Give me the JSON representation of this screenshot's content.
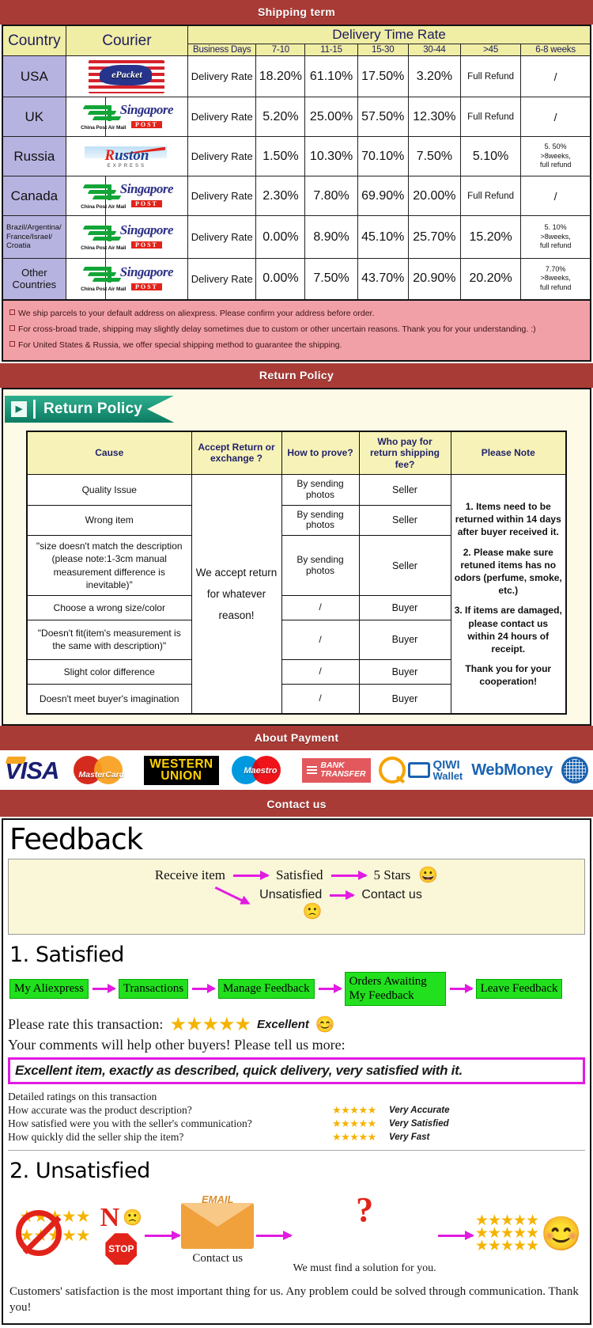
{
  "sections": {
    "shipping_banner": "Shipping term",
    "return_banner": "Return Policy",
    "payment_banner": "About Payment",
    "contact_banner": "Contact us"
  },
  "shipping": {
    "headers": {
      "country": "Country",
      "courier": "Courier",
      "delivery_time_rate": "Delivery Time Rate",
      "business_days": "Business Days",
      "d1": "7-10",
      "d2": "11-15",
      "d3": "15-30",
      "d4": "30-44",
      "d5": ">45",
      "d6": "6-8 weeks"
    },
    "rate_label": "Delivery Rate",
    "rows": [
      {
        "country": "USA",
        "couriers": [
          "epacket-logo"
        ],
        "rate_label": "Delivery Rate",
        "v1": "18.20%",
        "v2": "61.10%",
        "v3": "17.50%",
        "v4": "3.20%",
        "v5": "Full Refund",
        "v6": "/"
      },
      {
        "country": "UK",
        "couriers": [
          "china-post-air-mail-logo",
          "singapore-post-logo"
        ],
        "rate_label": "Delivery Rate",
        "v1": "5.20%",
        "v2": "25.00%",
        "v3": "57.50%",
        "v4": "12.30%",
        "v5": "Full Refund",
        "v6": "/"
      },
      {
        "country": "Russia",
        "couriers": [
          "ruston-express-logo"
        ],
        "rate_label": "Delivery Rate",
        "v1": "1.50%",
        "v2": "10.30%",
        "v3": "70.10%",
        "v4": "7.50%",
        "v5": "5.10%",
        "v6": "5. 50%\n>8weeks,\nfull refund"
      },
      {
        "country": "Canada",
        "couriers": [
          "china-post-air-mail-logo",
          "singapore-post-logo"
        ],
        "rate_label": "Delivery Rate",
        "v1": "2.30%",
        "v2": "7.80%",
        "v3": "69.90%",
        "v4": "20.00%",
        "v5": "Full Refund",
        "v6": "/"
      },
      {
        "country": "Brazil/Argentina/ France/Israel/ Croatia",
        "couriers": [
          "china-post-air-mail-logo",
          "singapore-post-logo"
        ],
        "rate_label": "Delivery Rate",
        "v1": "0.00%",
        "v2": "8.90%",
        "v3": "45.10%",
        "v4": "25.70%",
        "v5": "15.20%",
        "v6": "5. 10%\n>8weeks,\nfull refund"
      },
      {
        "country": "Other Countries",
        "couriers": [
          "china-post-air-mail-logo",
          "singapore-post-logo"
        ],
        "rate_label": "Delivery Rate",
        "v1": "0.00%",
        "v2": "7.50%",
        "v3": "43.70%",
        "v4": "20.90%",
        "v5": "20.20%",
        "v6": "7.70%\n>8weeks,\nfull refund"
      }
    ],
    "notices": [
      "We ship parcels to your default address on aliexpress. Please confirm your address before order.",
      "For cross-broad trade, shipping may slightly delay sometimes due to custom or other uncertain reasons. Thank you for your understanding. :)",
      "For United States & Russia, we offer special shipping method to guarantee the shipping."
    ]
  },
  "return_policy": {
    "tag_label": "Return Policy",
    "headers": {
      "cause": "Cause",
      "accept": "Accept Return or exchange ?",
      "prove": "How to prove?",
      "who_pays": "Who pay for return shipping fee?",
      "note": "Please Note"
    },
    "accept_text": "We accept return for whatever reason!",
    "rows": [
      {
        "cause": "Quality Issue",
        "prove": "By sending photos",
        "who": "Seller"
      },
      {
        "cause": "Wrong item",
        "prove": "By sending photos",
        "who": "Seller"
      },
      {
        "cause": "\"size doesn't match the description (please note:1-3cm manual measurement difference is inevitable)\"",
        "prove": "By sending photos",
        "who": "Seller"
      },
      {
        "cause": "Choose a wrong size/color",
        "prove": "/",
        "who": "Buyer"
      },
      {
        "cause": "\"Doesn't fit(item's measurement is the same with description)\"",
        "prove": "/",
        "who": "Buyer"
      },
      {
        "cause": "Slight color difference",
        "prove": "/",
        "who": "Buyer"
      },
      {
        "cause": "Doesn't meet buyer's imagination",
        "prove": "/",
        "who": "Buyer"
      }
    ],
    "notes": [
      "1. Items need to be returned within 14 days after buyer received it.",
      "2. Please make sure retuned items has no odors (perfume, smoke, etc.)",
      "3. If items are damaged, please contact us within 24 hours of receipt.",
      "Thank you for your cooperation!"
    ]
  },
  "payments": [
    {
      "name": "visa-logo",
      "label": "VISA"
    },
    {
      "name": "mastercard-logo",
      "label": "MasterCard"
    },
    {
      "name": "western-union-logo",
      "label1": "WESTERN",
      "label2": "UNION"
    },
    {
      "name": "maestro-logo",
      "label": "Maestro"
    },
    {
      "name": "bank-transfer-logo",
      "label1": "BANK",
      "label2": "TRANSFER"
    },
    {
      "name": "qiwi-wallet-logo",
      "label1": "QIWI",
      "label2": "Wallet"
    },
    {
      "name": "webmoney-logo",
      "label": "WebMoney"
    },
    {
      "name": "webmoney-globe-icon",
      "label": ""
    }
  ],
  "feedback": {
    "title": "Feedback",
    "flow": {
      "receive": "Receive item",
      "satisfied": "Satisfied",
      "five_stars": "5 Stars",
      "happy_emoji": "😀",
      "unsatisfied": "Unsatisfied",
      "contact_us": "Contact us",
      "sad_emoji": "🙁"
    },
    "satisfied_heading": "1. Satisfied",
    "steps": [
      "My Aliexpress",
      "Transactions",
      "Manage Feedback",
      "Orders Awaiting My Feedback",
      "Leave Feedback"
    ],
    "rate_label": "Please rate this transaction:",
    "rate_stars": "★★★★★",
    "rate_word": "Excellent",
    "rate_emoji": "😊",
    "comments_lead": "Your comments will help other buyers! Please tell us more:",
    "comment_text": "Excellent item, exactly as described, quick delivery, very satisfied with it.",
    "detailed_heading": "Detailed ratings on this transaction",
    "detailed": [
      {
        "question": "How accurate was the product description?",
        "stars": "★★★★★",
        "value": "Very Accurate"
      },
      {
        "question": "How satisfied were you with the seller's communication?",
        "stars": "★★★★★",
        "value": "Very Satisfied"
      },
      {
        "question": "How quickly did the seller ship the item?",
        "stars": "★★★★★",
        "value": "Very Fast"
      }
    ],
    "unsatisfied_heading": "2. Unsatisfied",
    "unsatisfied_graphics": {
      "no_word": "N",
      "stop_word": "STOP",
      "email_word": "EMAIL",
      "contact_caption": "Contact us",
      "solution_caption": "We must find a solution for you.",
      "stars_block": "★★★★★",
      "smiley": "😊"
    },
    "closing": "Customers' satisfaction is the most important thing for us. Any problem could be solved through communication. Thank you!"
  },
  "colors": {
    "banner_red": "#a93b36",
    "header_yellow": "#f0eda5",
    "country_purple": "#b7b3e0",
    "notice_pink": "#f2a0a8",
    "step_green": "#22e01e",
    "arrow_magenta": "#e21ae2",
    "star_gold": "#f5b301"
  }
}
